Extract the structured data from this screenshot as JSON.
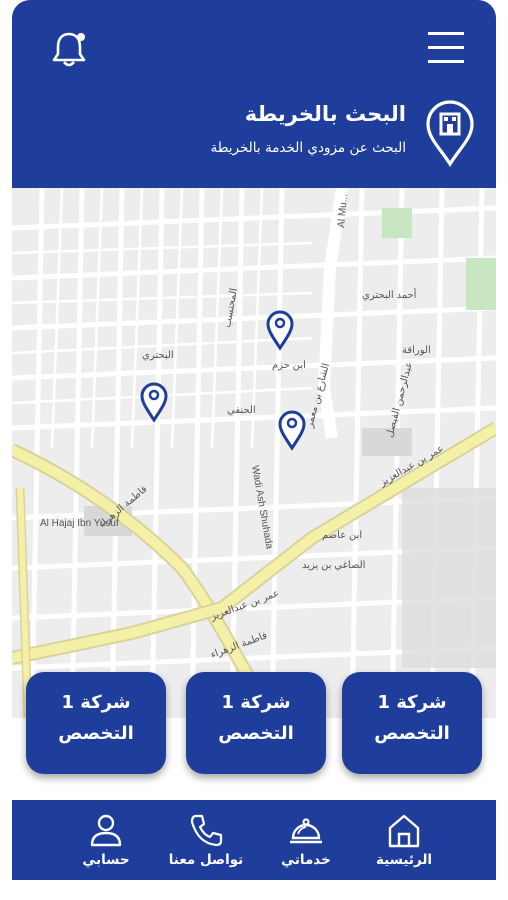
{
  "header": {
    "title": "البحث بالخريطة",
    "subtitle": "البحث عن مزودي الخدمة بالخريطة"
  },
  "icons": {
    "bell": "bell-icon",
    "menu": "menu-icon",
    "location": "location-pin-icon"
  },
  "map": {
    "street_labels": [
      "Al Hajaj Ibn Yusuf",
      "Wadi Ash Shuhada",
      "عمر بن عبدالعزيز",
      "فاطمة الزهراء",
      "عمر بن عبدالعزيز",
      "فاطمة الزهراء",
      "عبدالرحمن الفيصل",
      "الشارع بن معمر",
      "ابن عاصم",
      "الصاغي بن يزيد",
      "ابن حزم",
      "المحتسب",
      "الحنفي",
      "البحتري",
      "الوراقة",
      "أحمد البحتري",
      "Al Mu..."
    ]
  },
  "cards": [
    {
      "line1": "شركة 1",
      "line2": "التخصص"
    },
    {
      "line1": "شركة 1",
      "line2": "التخصص"
    },
    {
      "line1": "شركة 1",
      "line2": "التخصص"
    }
  ],
  "nav": [
    {
      "label": "الرئيسية",
      "icon": "home-icon"
    },
    {
      "label": "خدماتي",
      "icon": "service-bell-icon"
    },
    {
      "label": "تواصل معنا",
      "icon": "phone-icon"
    },
    {
      "label": "حسابي",
      "icon": "user-icon"
    }
  ],
  "colors": {
    "primary": "#1f3d9b",
    "map_bg": "#ededed",
    "main_road": "#f5f0a8",
    "park": "#c8e6c2"
  }
}
